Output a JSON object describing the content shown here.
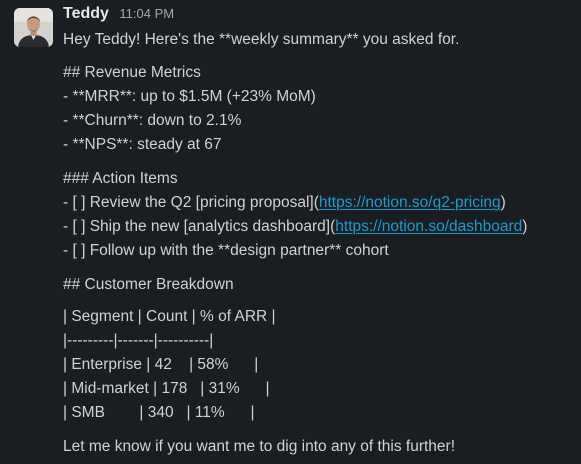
{
  "message": {
    "sender": "Teddy",
    "time": "11:04 PM",
    "intro": "Hey Teddy! Here's the **weekly summary** you asked for.",
    "revenue_heading": "## Revenue Metrics",
    "revenue_items": [
      "- **MRR**: up to $1.5M (+23% MoM)",
      "- **Churn**: down to 2.1%",
      "- **NPS**: steady at 67"
    ],
    "actions_heading": "### Action Items",
    "action_items": [
      {
        "prefix": "- [ ] Review the Q2 [pricing proposal](",
        "link": "https://notion.so/q2-pricing",
        "suffix": ")"
      },
      {
        "prefix": "- [ ] Ship the new [analytics dashboard](",
        "link": "https://notion.so/dashboard",
        "suffix": ")"
      },
      {
        "prefix": "- [ ] Follow up with the **design partner** cohort",
        "link": "",
        "suffix": ""
      }
    ],
    "breakdown_heading": "## Customer Breakdown",
    "table_lines": [
      "| Segment | Count | % of ARR |",
      "|---------|-------|----------|",
      "| Enterprise | 42    | 58%      |",
      "| Mid-market | 178   | 31%      |",
      "| SMB        | 340   | 11%      |"
    ],
    "closing": "Let me know if you want me to dig into any of this further!"
  },
  "colors": {
    "background": "#1a1d21",
    "text": "#d1d2d3",
    "link": "#1d9bd1",
    "timestamp": "#a6a7a9"
  },
  "avatar_icon": "user-photo"
}
